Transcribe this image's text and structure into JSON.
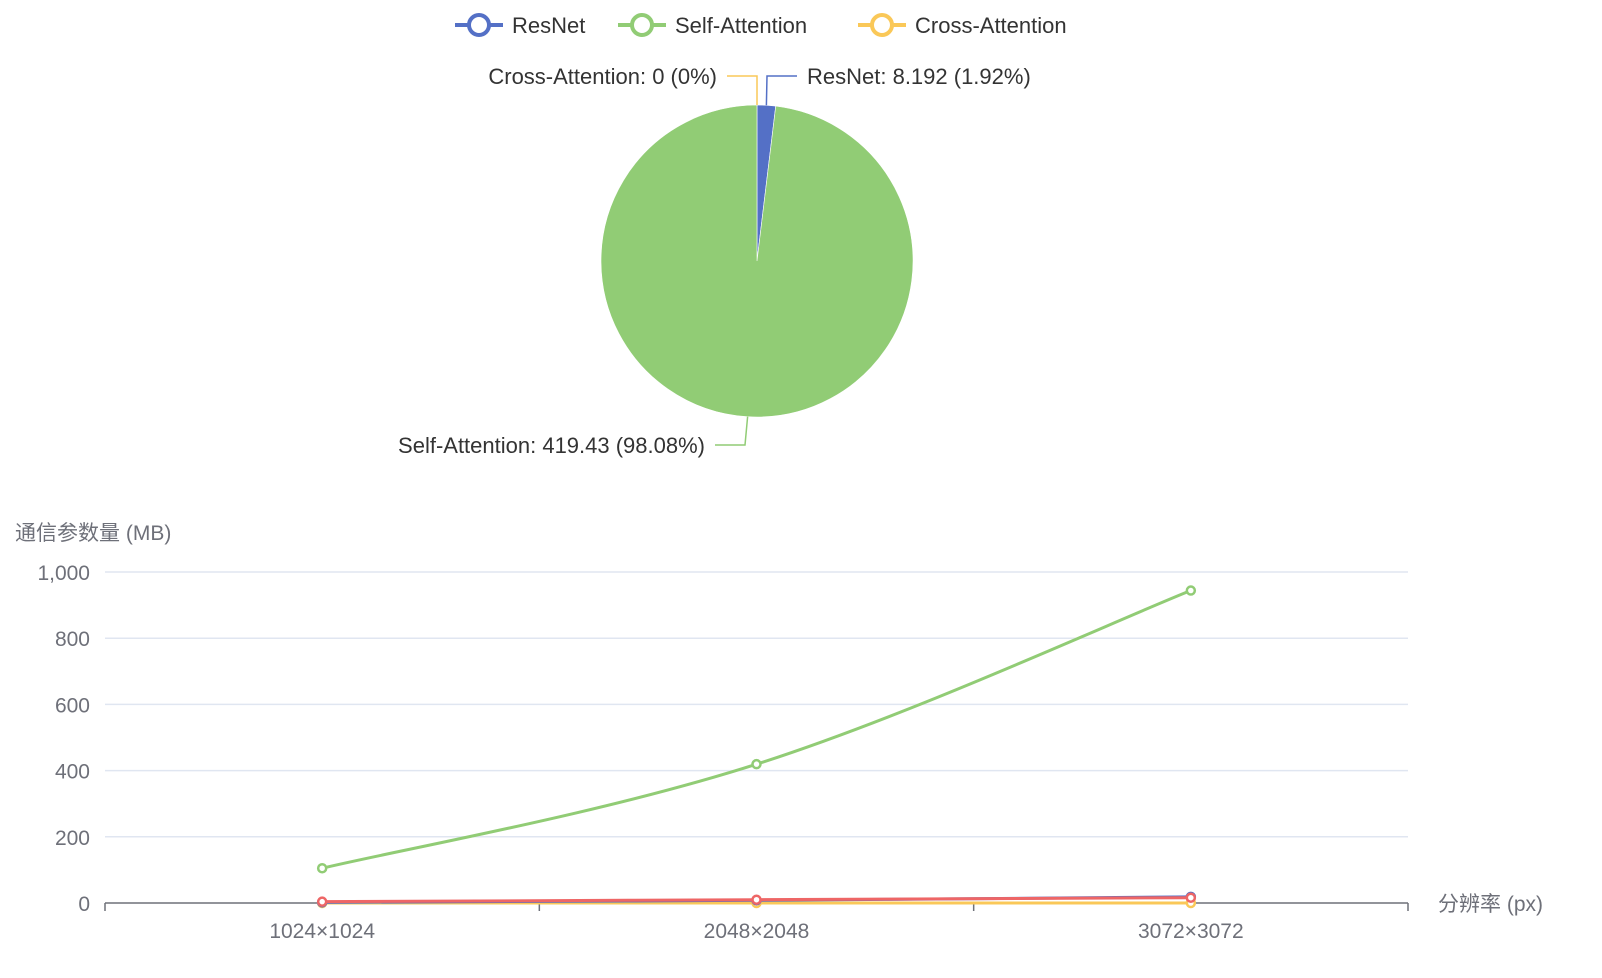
{
  "colors": {
    "resnet": "#5470c6",
    "self_attention": "#91cc75",
    "cross_attention": "#fac858",
    "red_series": "#ee6666",
    "grid": "#e0e6f1",
    "axis": "#6e7079",
    "label_text": "#333333"
  },
  "legend": {
    "items": [
      {
        "name": "ResNet",
        "color": "#5470c6"
      },
      {
        "name": "Self-Attention",
        "color": "#91cc75"
      },
      {
        "name": "Cross-Attention",
        "color": "#fac858"
      }
    ],
    "placement": "top-center"
  },
  "chart_data": [
    {
      "type": "pie",
      "title": "",
      "slices": [
        {
          "name": "ResNet",
          "value": 8.192,
          "percent": 1.92,
          "label": "ResNet: 8.192 (1.92%)",
          "color": "#5470c6"
        },
        {
          "name": "Self-Attention",
          "value": 419.43,
          "percent": 98.08,
          "label": "Self-Attention: 419.43 (98.08%)",
          "color": "#91cc75"
        },
        {
          "name": "Cross-Attention",
          "value": 0,
          "percent": 0,
          "label": "Cross-Attention: 0 (0%)",
          "color": "#fac858"
        }
      ]
    },
    {
      "type": "line",
      "title": "",
      "xlabel": "分辨率 (px)",
      "ylabel": "通信参数量 (MB)",
      "categories": [
        "1024×1024",
        "2048×2048",
        "3072×3072"
      ],
      "ylim": [
        0,
        1000
      ],
      "yticks": [
        0,
        200,
        400,
        600,
        800,
        1000
      ],
      "ytick_labels": [
        "0",
        "200",
        "400",
        "600",
        "800",
        "1,000"
      ],
      "grid": true,
      "smooth": true,
      "series": [
        {
          "name": "Self-Attention",
          "color": "#91cc75",
          "values": [
            105,
            419.43,
            944
          ]
        },
        {
          "name": "Cross-Attention",
          "color": "#fac858",
          "values": [
            0,
            0,
            0
          ]
        },
        {
          "name": "ResNet",
          "color": "#5470c6",
          "values": [
            2.048,
            8.192,
            18.432
          ]
        },
        {
          "color": "#ee6666",
          "values": [
            4,
            10,
            16
          ]
        }
      ]
    }
  ]
}
